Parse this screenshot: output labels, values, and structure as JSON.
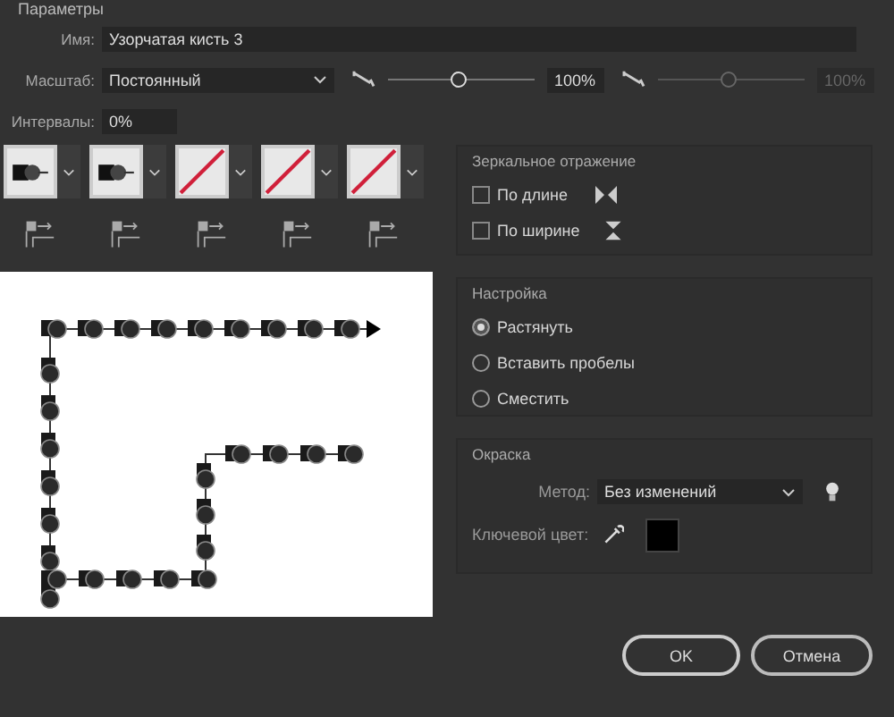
{
  "section_title": "Параметры",
  "name": {
    "label": "Имя:",
    "value": "Узорчатая кисть 3"
  },
  "scale": {
    "label": "Масштаб:",
    "value": "Постоянный",
    "slider": {
      "level": 0.47,
      "value": "100%",
      "disabled": false
    },
    "slider2": {
      "level": 0.47,
      "value": "100%",
      "disabled": true
    }
  },
  "spacing": {
    "label": "Интервалы:",
    "value": "0%"
  },
  "tiles": [
    {
      "kind": "pattern"
    },
    {
      "kind": "pattern"
    },
    {
      "kind": "none"
    },
    {
      "kind": "none"
    },
    {
      "kind": "none"
    }
  ],
  "flip": {
    "title": "Зеркальное отражение",
    "options": [
      {
        "label": "По длине",
        "checked": false
      },
      {
        "label": "По ширине",
        "checked": false
      }
    ]
  },
  "fit": {
    "title": "Настройка",
    "options": [
      {
        "label": "Растянуть",
        "selected": true
      },
      {
        "label": "Вставить пробелы",
        "selected": false
      },
      {
        "label": "Сместить",
        "selected": false
      }
    ]
  },
  "colorization": {
    "title": "Окраска",
    "method_label": "Метод:",
    "method": "Без изменений",
    "key_color_label": "Ключевой цвет:",
    "key_swatch": {
      "color": "#000000"
    }
  },
  "buttons": [
    {
      "label": "OK",
      "kind": "primary"
    },
    {
      "label": "Отмена",
      "kind": "secondary"
    }
  ]
}
